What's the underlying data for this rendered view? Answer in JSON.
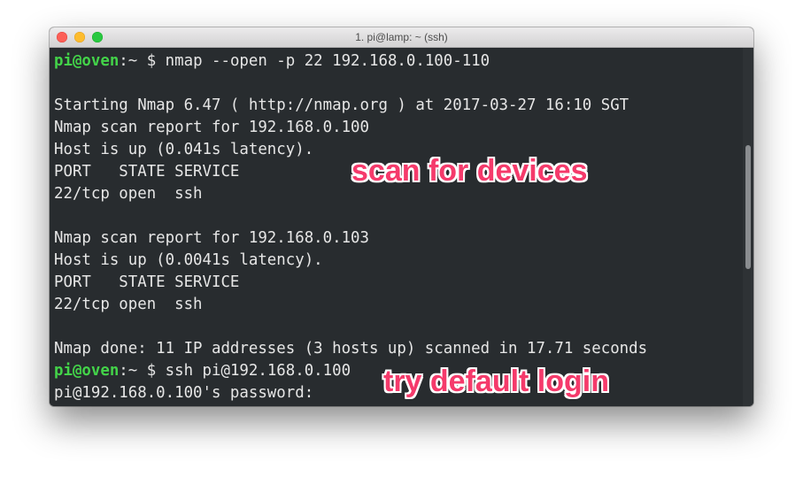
{
  "window": {
    "title": "1. pi@lamp: ~ (ssh)"
  },
  "terminal": {
    "lines": [
      {
        "user": "pi@oven",
        "path": ":~ $",
        "text": " nmap --open -p 22 192.168.0.100-110"
      },
      {
        "text": ""
      },
      {
        "text": "Starting Nmap 6.47 ( http://nmap.org ) at 2017-03-27 16:10 SGT"
      },
      {
        "text": "Nmap scan report for 192.168.0.100"
      },
      {
        "text": "Host is up (0.041s latency)."
      },
      {
        "text": "PORT   STATE SERVICE"
      },
      {
        "text": "22/tcp open  ssh"
      },
      {
        "text": ""
      },
      {
        "text": "Nmap scan report for 192.168.0.103"
      },
      {
        "text": "Host is up (0.0041s latency)."
      },
      {
        "text": "PORT   STATE SERVICE"
      },
      {
        "text": "22/tcp open  ssh"
      },
      {
        "text": ""
      },
      {
        "text": "Nmap done: 11 IP addresses (3 hosts up) scanned in 17.71 seconds"
      },
      {
        "user": "pi@oven",
        "path": ":~ $",
        "text": " ssh pi@192.168.0.100"
      },
      {
        "text": "pi@192.168.0.100's password:"
      }
    ]
  },
  "annotations": {
    "scan": "scan for devices",
    "login": "try default login"
  },
  "colors": {
    "background": "#282c2f",
    "prompt": "#43d349",
    "annotation": "#f53a6b"
  }
}
